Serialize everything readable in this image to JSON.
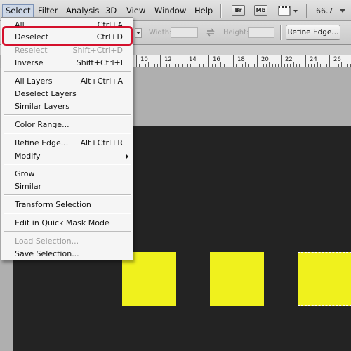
{
  "menubar": {
    "items": [
      "Select",
      "Filter",
      "Analysis",
      "3D",
      "View",
      "Window",
      "Help"
    ],
    "app_buttons": [
      "Br",
      "Mb"
    ],
    "zoom": "66.7"
  },
  "options": {
    "width_label": "Width:",
    "height_label": "Height:",
    "refine_edge_label": "Refine Edge..."
  },
  "ruler": {
    "labels": [
      "10",
      "12",
      "14",
      "16",
      "18",
      "20",
      "22",
      "24",
      "26"
    ]
  },
  "select_menu": {
    "items": [
      {
        "label": "All",
        "shortcut": "Ctrl+A",
        "disabled": false
      },
      {
        "label": "Deselect",
        "shortcut": "Ctrl+D",
        "disabled": false
      },
      {
        "label": "Reselect",
        "shortcut": "Shift+Ctrl+D",
        "disabled": true
      },
      {
        "label": "Inverse",
        "shortcut": "Shift+Ctrl+I",
        "disabled": false
      },
      {
        "label": "All Layers",
        "shortcut": "Alt+Ctrl+A",
        "disabled": false
      },
      {
        "label": "Deselect Layers",
        "shortcut": "",
        "disabled": false
      },
      {
        "label": "Similar Layers",
        "shortcut": "",
        "disabled": false
      },
      {
        "label": "Color Range...",
        "shortcut": "",
        "disabled": false
      },
      {
        "label": "Refine Edge...",
        "shortcut": "Alt+Ctrl+R",
        "disabled": false
      },
      {
        "label": "Modify",
        "shortcut": "",
        "disabled": false
      },
      {
        "label": "Grow",
        "shortcut": "",
        "disabled": false
      },
      {
        "label": "Similar",
        "shortcut": "",
        "disabled": false
      },
      {
        "label": "Transform Selection",
        "shortcut": "",
        "disabled": false
      },
      {
        "label": "Edit in Quick Mask Mode",
        "shortcut": "",
        "disabled": false
      },
      {
        "label": "Load Selection...",
        "shortcut": "",
        "disabled": true
      },
      {
        "label": "Save Selection...",
        "shortcut": "",
        "disabled": false
      }
    ]
  },
  "colors": {
    "shape_fill": "#f0f11d",
    "canvas": "#232323",
    "highlight": "#d4102c"
  }
}
